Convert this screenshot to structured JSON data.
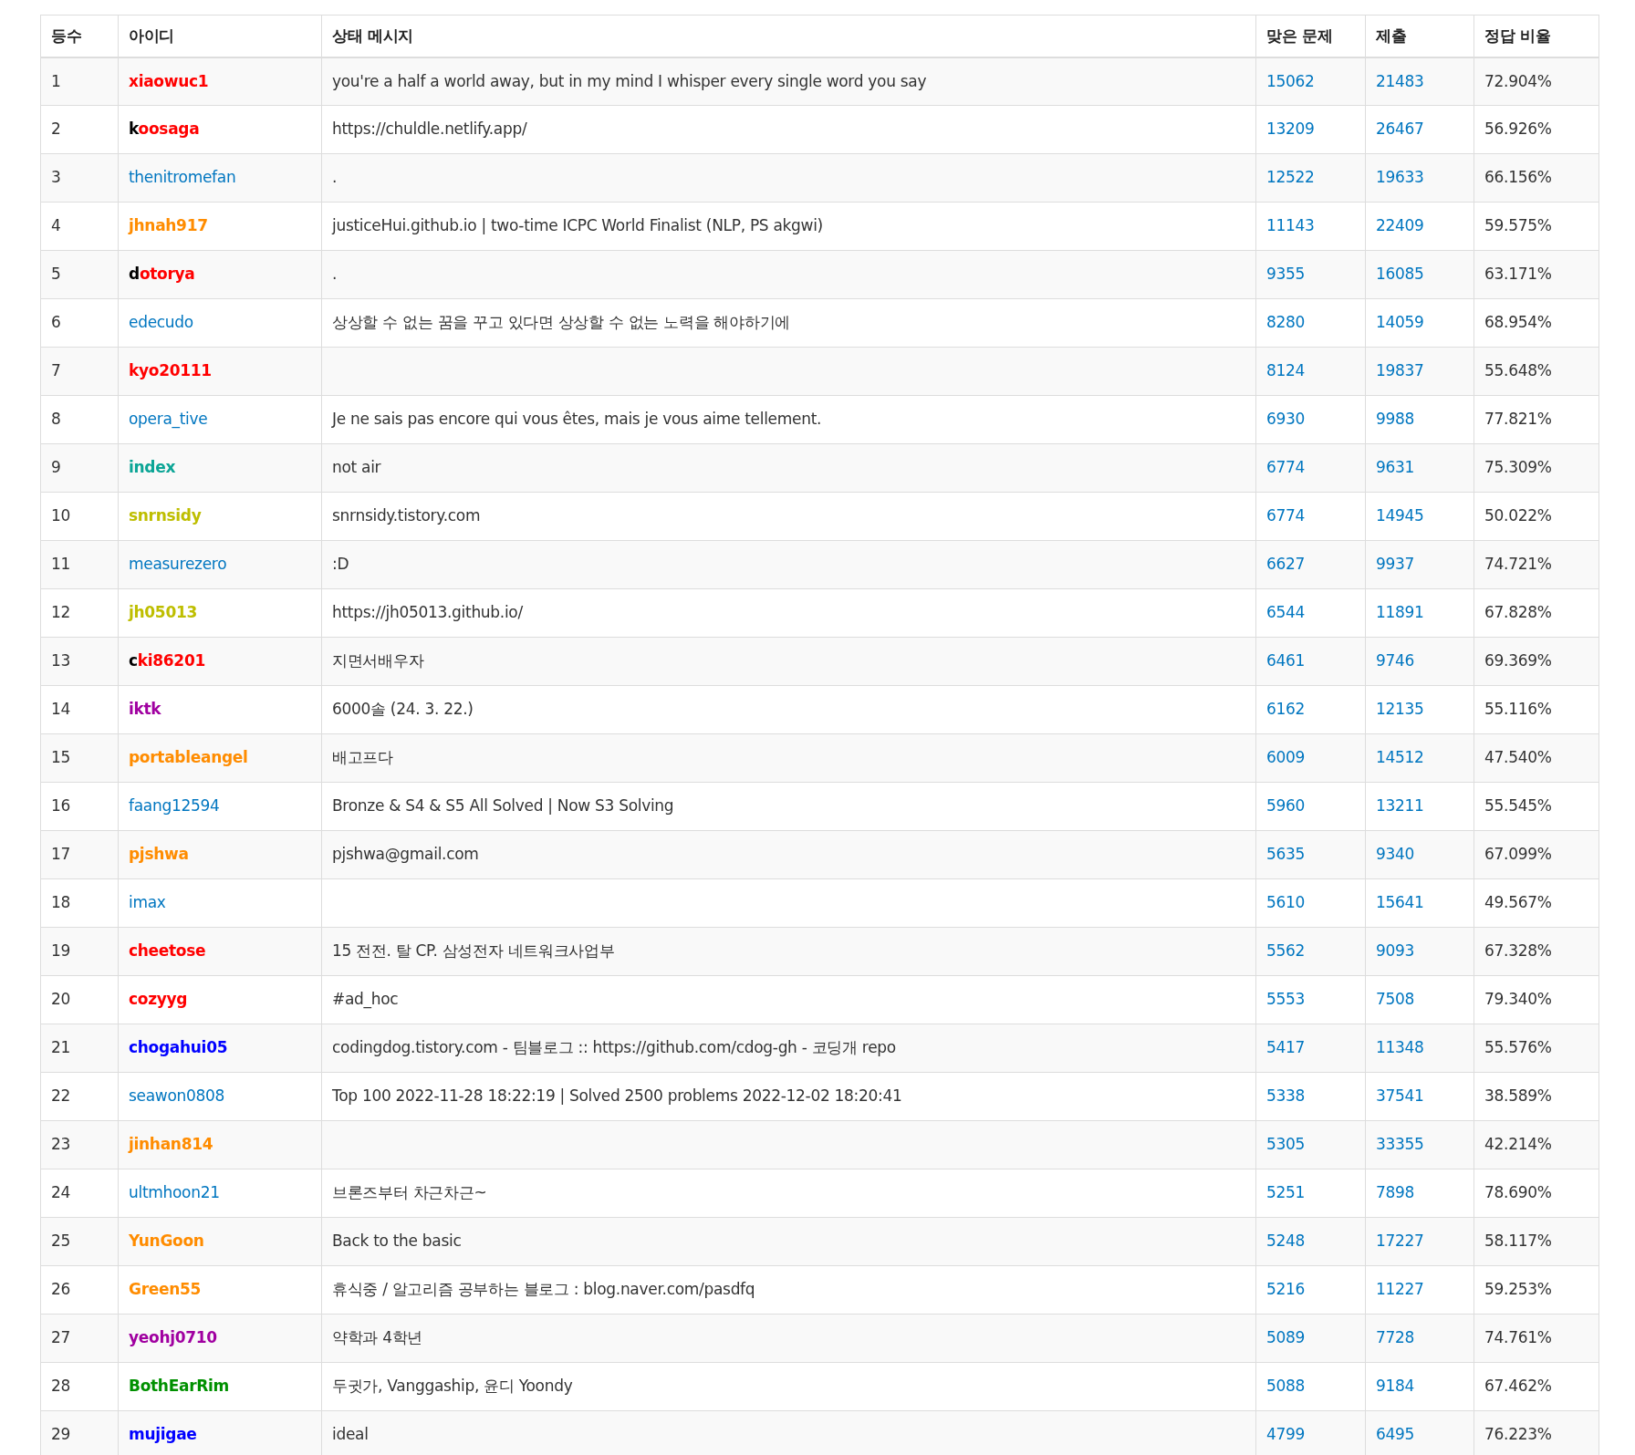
{
  "table": {
    "columns": [
      "등수",
      "아이디",
      "상태 메시지",
      "맞은 문제",
      "제출",
      "정답 비율"
    ],
    "rows": [
      {
        "rank": "1",
        "user": "xiaowuc1",
        "kind": "colored",
        "color": "#ff0000",
        "status": "you're a half a world away, but in my mind I whisper every single word you say",
        "solved": "15062",
        "submissions": "21483",
        "ratio": "72.904%"
      },
      {
        "rank": "2",
        "user": "koosaga",
        "kind": "split",
        "color": "#ff0000",
        "status": "https://chuldle.netlify.app/",
        "solved": "13209",
        "submissions": "26467",
        "ratio": "56.926%"
      },
      {
        "rank": "3",
        "user": "thenitromefan",
        "kind": "plain",
        "status": ".",
        "solved": "12522",
        "submissions": "19633",
        "ratio": "66.156%"
      },
      {
        "rank": "4",
        "user": "jhnah917",
        "kind": "colored",
        "color": "#ff8c00",
        "status": "justiceHui.github.io | two-time ICPC World Finalist (NLP, PS akgwi)",
        "solved": "11143",
        "submissions": "22409",
        "ratio": "59.575%"
      },
      {
        "rank": "5",
        "user": "dotorya",
        "kind": "split",
        "color": "#ff0000",
        "status": ".",
        "solved": "9355",
        "submissions": "16085",
        "ratio": "63.171%"
      },
      {
        "rank": "6",
        "user": "edecudo",
        "kind": "plain",
        "status": "상상할 수 없는 꿈을 꾸고 있다면 상상할 수 없는 노력을 해야하기에",
        "solved": "8280",
        "submissions": "14059",
        "ratio": "68.954%"
      },
      {
        "rank": "7",
        "user": "kyo20111",
        "kind": "colored",
        "color": "#ff0000",
        "solved": "8124",
        "submissions": "19837",
        "ratio": "55.648%"
      },
      {
        "rank": "8",
        "user": "opera_tive",
        "kind": "plain",
        "status": "Je ne sais pas encore qui vous êtes, mais je vous aime tellement.",
        "solved": "6930",
        "submissions": "9988",
        "ratio": "77.821%"
      },
      {
        "rank": "9",
        "user": "index",
        "kind": "colored",
        "color": "#0ca596",
        "status": "not air",
        "solved": "6774",
        "submissions": "9631",
        "ratio": "75.309%"
      },
      {
        "rank": "10",
        "user": "snrnsidy",
        "kind": "colored",
        "color": "#bebe00",
        "status": "snrnsidy.tistory.com",
        "solved": "6774",
        "submissions": "14945",
        "ratio": "50.022%"
      },
      {
        "rank": "11",
        "user": "measurezero",
        "kind": "plain",
        "status": ":D",
        "solved": "6627",
        "submissions": "9937",
        "ratio": "74.721%"
      },
      {
        "rank": "12",
        "user": "jh05013",
        "kind": "colored",
        "color": "#bebe00",
        "status": "https://jh05013.github.io/",
        "solved": "6544",
        "submissions": "11891",
        "ratio": "67.828%"
      },
      {
        "rank": "13",
        "user": "cki86201",
        "kind": "split",
        "color": "#ff0000",
        "status": "지면서배우자",
        "solved": "6461",
        "submissions": "9746",
        "ratio": "69.369%"
      },
      {
        "rank": "14",
        "user": "iktk",
        "kind": "colored",
        "color": "#a000a0",
        "status": "6000솔 (24. 3. 22.)",
        "solved": "6162",
        "submissions": "12135",
        "ratio": "55.116%"
      },
      {
        "rank": "15",
        "user": "portableangel",
        "kind": "colored",
        "color": "#ff8c00",
        "status": "배고프다",
        "solved": "6009",
        "submissions": "14512",
        "ratio": "47.540%"
      },
      {
        "rank": "16",
        "user": "faang12594",
        "kind": "plain",
        "status": "Bronze & S4 & S5 All Solved | Now S3 Solving",
        "solved": "5960",
        "submissions": "13211",
        "ratio": "55.545%"
      },
      {
        "rank": "17",
        "user": "pjshwa",
        "kind": "colored",
        "color": "#ff8c00",
        "status": "pjshwa@gmail.com",
        "solved": "5635",
        "submissions": "9340",
        "ratio": "67.099%"
      },
      {
        "rank": "18",
        "user": "imax",
        "kind": "plain",
        "solved": "5610",
        "submissions": "15641",
        "ratio": "49.567%"
      },
      {
        "rank": "19",
        "user": "cheetose",
        "kind": "colored",
        "color": "#ff0000",
        "status": "15 전전. 탈 CP. 삼성전자 네트워크사업부",
        "solved": "5562",
        "submissions": "9093",
        "ratio": "67.328%"
      },
      {
        "rank": "20",
        "user": "cozyyg",
        "kind": "colored",
        "color": "#ff0000",
        "status": "#ad_hoc",
        "solved": "5553",
        "submissions": "7508",
        "ratio": "79.340%"
      },
      {
        "rank": "21",
        "user": "chogahui05",
        "kind": "colored",
        "color": "#0000ff",
        "status": "codingdog.tistory.com - 팀블로그 :: https://github.com/cdog-gh - 코딩개 repo",
        "solved": "5417",
        "submissions": "11348",
        "ratio": "55.576%"
      },
      {
        "rank": "22",
        "user": "seawon0808",
        "kind": "plain",
        "status": "Top 100 2022-11-28 18:22:19 | Solved 2500 problems 2022-12-02 18:20:41",
        "solved": "5338",
        "submissions": "37541",
        "ratio": "38.589%"
      },
      {
        "rank": "23",
        "user": "jinhan814",
        "kind": "colored",
        "color": "#ff8c00",
        "solved": "5305",
        "submissions": "33355",
        "ratio": "42.214%"
      },
      {
        "rank": "24",
        "user": "ultmhoon21",
        "kind": "plain",
        "status": "브론즈부터 차근차근~",
        "solved": "5251",
        "submissions": "7898",
        "ratio": "78.690%"
      },
      {
        "rank": "25",
        "user": "YunGoon",
        "kind": "colored",
        "color": "#ff8c00",
        "status": "Back to the basic",
        "solved": "5248",
        "submissions": "17227",
        "ratio": "58.117%"
      },
      {
        "rank": "26",
        "user": "Green55",
        "kind": "colored",
        "color": "#ff8c00",
        "status": "휴식중 / 알고리즘 공부하는 블로그 : blog.naver.com/pasdfq",
        "solved": "5216",
        "submissions": "11227",
        "ratio": "59.253%"
      },
      {
        "rank": "27",
        "user": "yeohj0710",
        "kind": "colored",
        "color": "#a000a0",
        "status": "약학과 4학년",
        "solved": "5089",
        "submissions": "7728",
        "ratio": "74.761%"
      },
      {
        "rank": "28",
        "user": "BothEarRim",
        "kind": "colored",
        "color": "#009000",
        "status": "두귓가, Vanggaship, 윤디 Yoondy",
        "solved": "5088",
        "submissions": "9184",
        "ratio": "67.462%"
      },
      {
        "rank": "29",
        "user": "mujigae",
        "kind": "colored",
        "color": "#0000ff",
        "status": "ideal",
        "solved": "4799",
        "submissions": "6495",
        "ratio": "76.223%"
      }
    ]
  }
}
